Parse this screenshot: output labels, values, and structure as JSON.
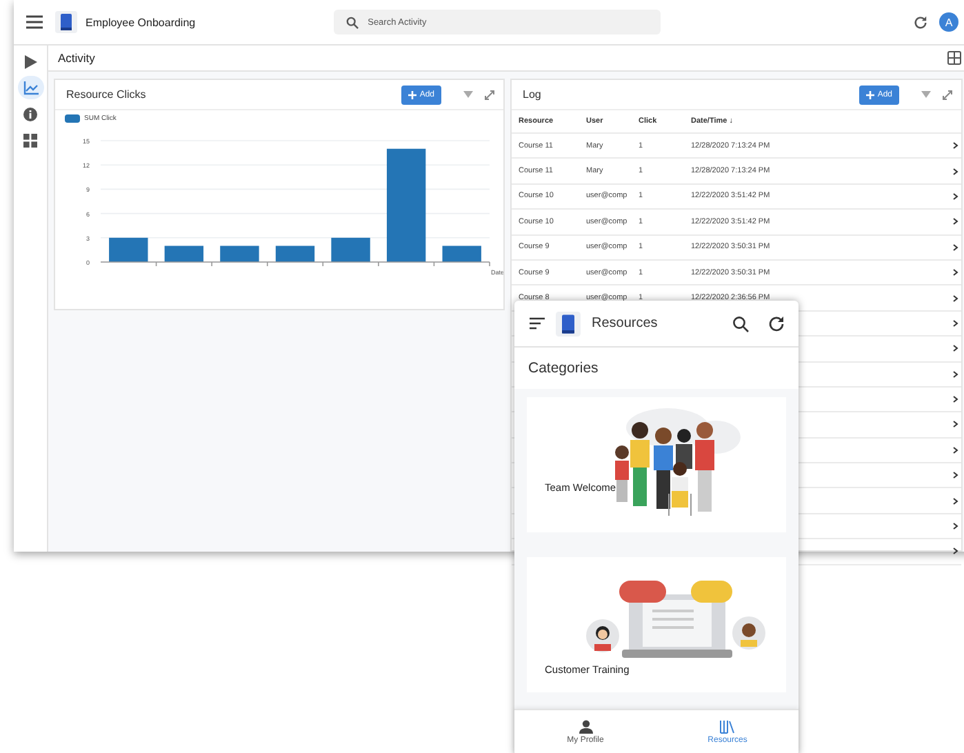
{
  "app_bar": {
    "title": "Employee Onboarding",
    "search": {
      "placeholder": "Search Activity"
    },
    "avatar": "A"
  },
  "sidebar": {
    "items": [
      {
        "kind": "play",
        "selected": false
      },
      {
        "kind": "chart",
        "selected": true
      },
      {
        "kind": "info",
        "selected": false
      },
      {
        "kind": "grid",
        "selected": false
      }
    ]
  },
  "page": {
    "title": "Activity"
  },
  "chart_panel": {
    "title": "Resource Clicks",
    "add_button": "Add",
    "chart_data": {
      "type": "bar",
      "grid": true,
      "xlabel": "Date",
      "ylim": [
        0,
        15
      ],
      "yticks": [
        0,
        3,
        6,
        9,
        12,
        15
      ],
      "series": [
        {
          "name": "SUM Click",
          "color": "#2475b5",
          "values": [
            3,
            2,
            2,
            2,
            3,
            14,
            2
          ]
        }
      ]
    }
  },
  "log_panel": {
    "title": "Log",
    "add_button": "Add",
    "columns": [
      "Resource",
      "User",
      "Click",
      "Date/Time ↓"
    ],
    "rows": [
      {
        "cells": [
          "Course 11",
          "Mary",
          "1",
          "12/28/2020 7:13:24 PM"
        ]
      },
      {
        "cells": [
          "Course 11",
          "Mary",
          "1",
          "12/28/2020 7:13:24 PM"
        ]
      },
      {
        "cells": [
          "Course 10",
          "user@comp",
          "1",
          "12/22/2020 3:51:42 PM"
        ]
      },
      {
        "cells": [
          "Course 10",
          "user@comp",
          "1",
          "12/22/2020 3:51:42 PM"
        ]
      },
      {
        "cells": [
          "Course 9",
          "user@comp",
          "1",
          "12/22/2020 3:50:31 PM"
        ]
      },
      {
        "cells": [
          "Course 9",
          "user@comp",
          "1",
          "12/22/2020 3:50:31 PM"
        ]
      },
      {
        "cells": [
          "Course 8",
          "user@comp",
          "1",
          "12/22/2020 2:36:56 PM"
        ]
      },
      {},
      {},
      {},
      {},
      {},
      {},
      {},
      {},
      {},
      {}
    ]
  },
  "phone": {
    "title": "Resources",
    "section": "Categories",
    "cards": [
      {
        "kind": "team",
        "label": "Team Welcome"
      },
      {
        "kind": "training",
        "label": "Customer Training"
      }
    ],
    "nav": [
      {
        "kind": "profile",
        "label": "My Profile",
        "selected": false
      },
      {
        "kind": "library",
        "label": "Resources",
        "selected": true
      }
    ]
  }
}
